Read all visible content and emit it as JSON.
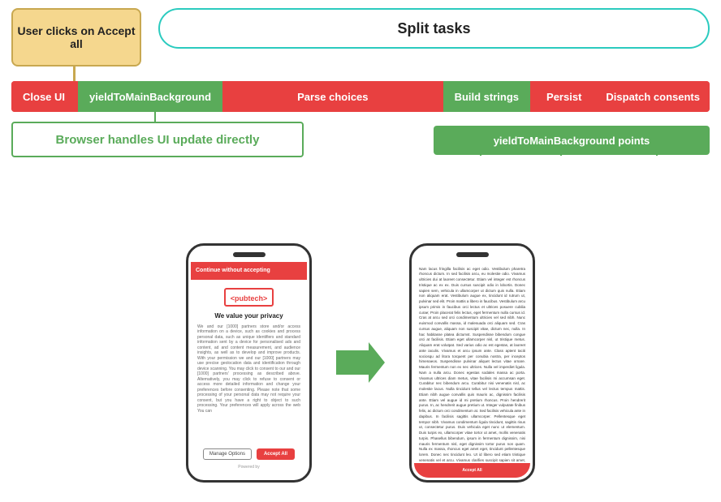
{
  "diagram": {
    "user_clicks_label": "User clicks on Accept all",
    "split_tasks_label": "Split tasks",
    "pipeline": {
      "close_ui": "Close UI",
      "yield_main": "yieldToMainBackground",
      "parse_choices": "Parse choices",
      "build_strings": "Build strings",
      "persist": "Persist",
      "dispatch_consents": "Dispatch consents"
    },
    "browser_box": "Browser handles UI update directly",
    "yield_points": "yieldToMainBackground  points"
  },
  "phones": {
    "left": {
      "top_bar": "Continue without accepting",
      "pubtech": "<pubtech>",
      "privacy_title": "We value your privacy",
      "small_text": "We and our [1000] partners store and/or access information on a device, such as cookies and process personal data, such as unique identifiers and standard information sent by a device for personalised ads and content, ad and content measurement, and audience insights, as well as to develop and improve products. With your permission we and our [1000] partners may use precise geolocation data and identification through device scanning. You may click to consent to our and our [1000] partners' processing as described above. Alternatively, you may click to refuse to consent or access more detailed information and change your preferences before consenting. Please note that some processing of your personal data may not require your consent, but you have a right to object to such processing. Your preferences will apply across the web You can",
      "manage_options": "Manage Options",
      "accept_all": "Accept All",
      "powered_by": "Powered by"
    },
    "right": {
      "article_text": "Nam lacus fringilla facilisis ac eget odio. Vestibulum pharetra rhoncus dictum. In sed facilisis arcu, eu molestie odio. Vivamus ultricies dui at laoreet consectetur. Etiam vel integer est rhoncus tristique ac ex ex. Duis cursus suscipit odio in lobortis. Donec sapien sem, vehicula in ullamcorper ut dictum quis nulla. Etiam non aliquam erat. Vestibulum augue ex, tincidunt id rutrum ut, pulvinar sed elit. Proin mattis a libero in faucibus. Vestibulum arcu ipsum primis in faucibus orci lectus et ultrices posuere cubilia curae; Proin placerat felis lectus, eget fermentum nulla cursus id. Cras at arcu sed orci condimentum ultricies vel sed nibh. Nunc euismod convallis massa, id malesuada orci aliquam sed. Cras cursus augue, aliquam non suscipit vitae, dictum nec, nulla. In hac habitasse platea dictumst. Suspendisse bibendum congue orci at facilisis. Etiam eget ullamcorper nisl, ut tristique metus. Aliquam erat volutpat. Sed varius odio ac est egestas, at laoreet ante iaculis. Vivamus et arcu ipsum ante. Class aptent taciti sociosqu ad litora torquent per conubia nostra, per inceptos himenaeos. Suspendisse pulvinar aliquet lectus vitae ornare. Mauris fermentum non ex nec ultrices. Nulla vel imperdiet ligula. Nam a nulla arcu. Donec egestas sodales massa ac porta. Vivamus ultrices diam metus, vitae facilisis mi accumsan eget. Curabitur nec bibendum arcu. Curabitur nisi venenatis nisl, ac molestie lacus. Nulla tincidunt tellus vel lectus tempus mattis. Etiam nibh augue convallis quis mauris ac, dignissim facilisis ante. Etiam vel augue id mi pretium rhoncus. Proin hendrerit purus. In, ac hendrerit augue pretium ut. Integer vulputate finibus felis, ac dictum orci condimentum at. Sed facilisis vehicula ante in dapibus. In facilisis sagittis ullamcorper. Pellentesque eget tempor nibh. Vivamus condimentum ligula tincidunt, sagittis risus ut, consectetur purus. Duis vehicula eget nunc ut elementum. Duis turpis ex, ullamcorper vitae tortor ut amet, mollis venenatis turpis. Phasellus bibendum, ipsum in fermentum dignissim, nisi mauris fermentum nisl, eget dignissim tortor purus non quam. Nulla ex massa, rhoncus eget amet eget, tincidunt pellentesque lorem. Donec nec tincidunt leo. Ut id libero sed etiam tristique venenatis vel et arcu. Vivamus clarifies suscipit sapien sit amet, porta ligula. Proin augue nulla, pharetra id mollis sed, vulputate sed ante. Integer ultrices ex erat maximus viverra id luctus sed. Lorem ipsum dolor sit amet, consectetur adipiscing elit. Aliquam a enim vel nibh sodales mattis erat eleifend felis. Sed id tellus ege",
      "consent_bar": "Accept All"
    }
  }
}
